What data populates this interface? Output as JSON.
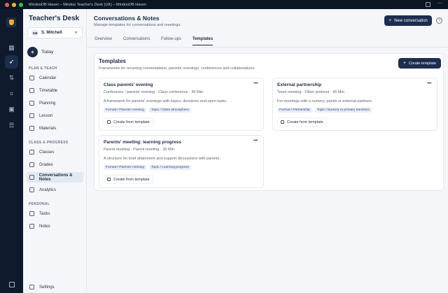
{
  "window": {
    "title": "MindooDB Haven – Mindoo Teacher's Desk (UK) – MindooDB Haven"
  },
  "sidebar": {
    "brand": "Teacher's Desk",
    "user": {
      "initials": "SM",
      "name": "S. Mitchell"
    },
    "today_label": "Today",
    "sections": [
      {
        "label": "PLAN & TEACH",
        "items": [
          "Calendar",
          "Timetable",
          "Planning",
          "Lesson",
          "Materials"
        ]
      },
      {
        "label": "CLASS & PROGRESS",
        "items": [
          "Classes",
          "Grades",
          "Conversations & Notes",
          "Analytics"
        ]
      },
      {
        "label": "PERSONAL",
        "items": [
          "Tasks",
          "Notes"
        ]
      }
    ],
    "settings_label": "Settings",
    "active_item": "Conversations & Notes"
  },
  "header": {
    "title": "Conversations & Notes",
    "subtitle": "Manage templates for conversations and meetings.",
    "new_button": "New conversation"
  },
  "tabs": [
    "Overview",
    "Conversations",
    "Follow-ups",
    "Templates"
  ],
  "active_tab": "Templates",
  "templates_panel": {
    "title": "Templates",
    "subtitle": "Frameworks for recurring conversations, parents' evenings, conferences and collaborations.",
    "create_button": "Create template",
    "cards": [
      {
        "title": "Class parents' evening",
        "meta": "Conference / parents' evening · Class conference · 90 Min.",
        "description": "A framework for parents' evenings with topics, decisions and open tasks.",
        "tags": [
          "Format / Parents' evening",
          "Topic / Class atmosphere"
        ],
        "button": "Create from template"
      },
      {
        "title": "External partnership",
        "meta": "Team meeting · Other protocol · 45 Min.",
        "description": "For meetings with a nursery, parish or external partners.",
        "tags": [
          "Format / Partnership",
          "Topic / Nursery to primary transition"
        ],
        "button": "Create from template"
      },
      {
        "title": "Parents' meeting: learning progress",
        "meta": "Parent meeting · Parent meeting · 30 Min.",
        "description": "A structure for brief attainment and support discussions with parents.",
        "tags": [
          "Format / Parents' meeting",
          "Topic / Learning progress"
        ],
        "button": "Create from template"
      }
    ]
  },
  "colors": {
    "accent": "#1c2d4f",
    "rail_bg": "#0f1b2d",
    "tag_bg": "#e8eef8"
  }
}
